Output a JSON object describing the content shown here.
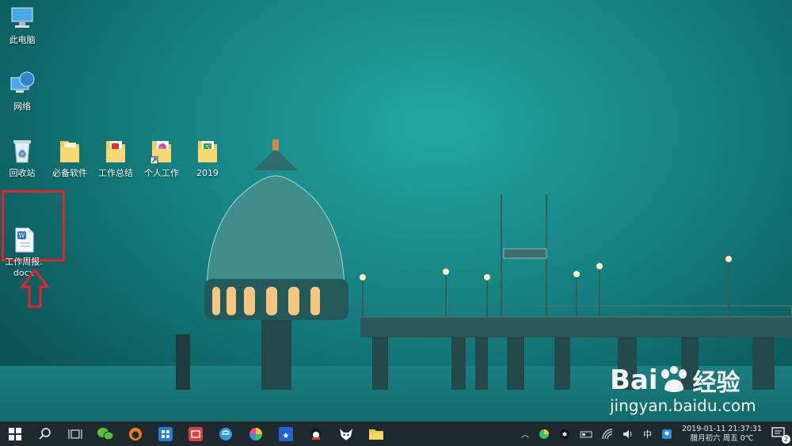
{
  "desktop": {
    "icons": [
      {
        "label": "此电脑"
      },
      {
        "label": "网络"
      },
      {
        "label": "回收站"
      },
      {
        "label": "必备软件"
      },
      {
        "label": "工作总结"
      },
      {
        "label": "个人工作"
      },
      {
        "label": "2019"
      },
      {
        "label": "工作周报.\ndocx"
      }
    ]
  },
  "tray": {
    "ime": "中",
    "clock_time": "2019-01-11 21:37:31",
    "clock_date": "腊月初六 周五 0℃",
    "notifications_count": "2"
  },
  "watermark": {
    "brand": "Bai",
    "brand_cn": "经验",
    "url": "jingyan.baidu.com"
  },
  "colors": {
    "taskbar": "#1f2a2e",
    "highlight_box": "#e5232a",
    "accent": "#0078d7"
  }
}
